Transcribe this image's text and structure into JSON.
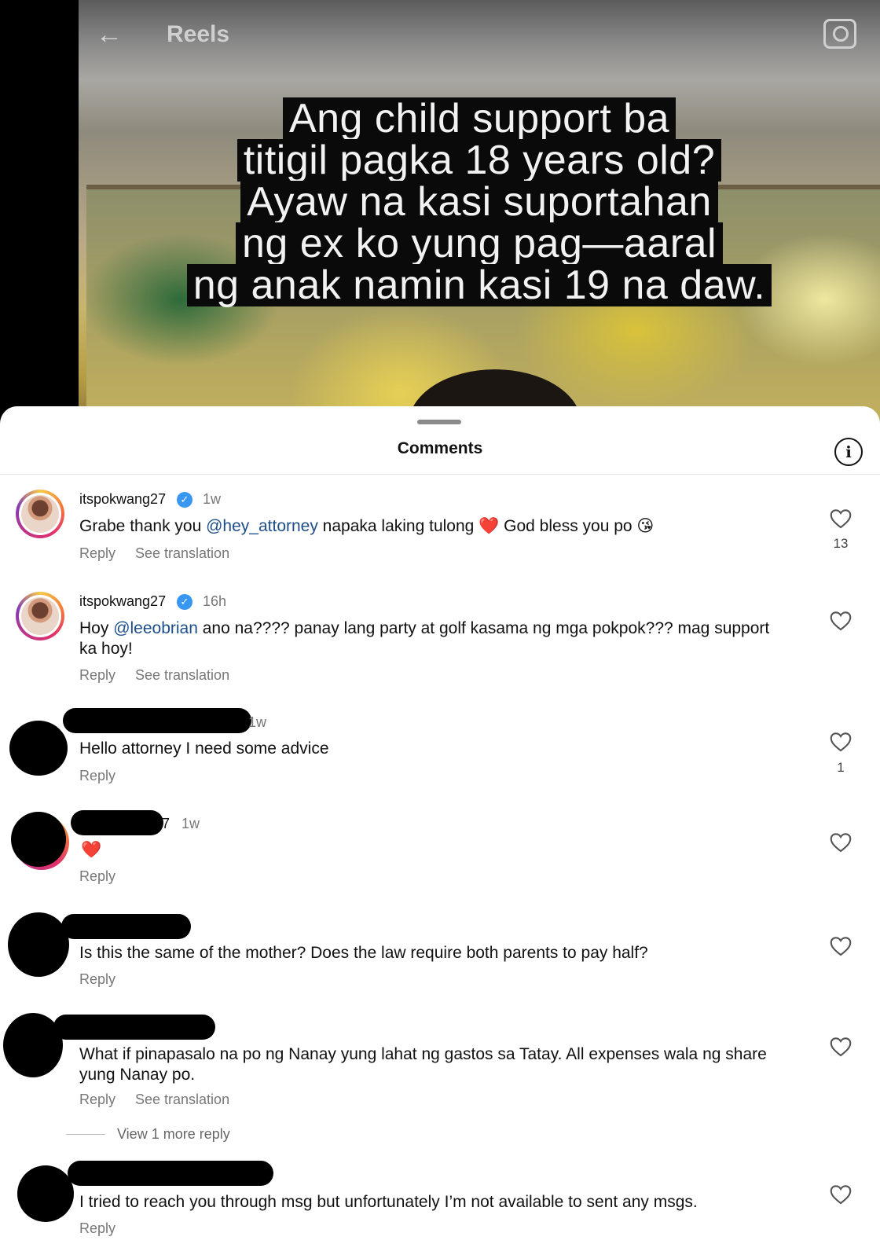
{
  "header": {
    "back_icon": "arrow-left-icon",
    "title": "Reels",
    "camera_icon": "camera-icon"
  },
  "video": {
    "caption_lines": [
      "Ang child support ba",
      "titigil pagka 18 years old?",
      "Ayaw na kasi suportahan",
      "ng ex ko yung pag—aaral",
      "ng anak namin kasi 19 na daw."
    ]
  },
  "sheet": {
    "title": "Comments",
    "info_icon": "info-icon"
  },
  "comments": [
    {
      "username": "itspokwang27",
      "verified": true,
      "time": "1w",
      "text_before": "Grabe thank you ",
      "mention": "@hey_attorney",
      "text_after": " napaka laking tulong ❤️ God bless you po 😘",
      "reply": "Reply",
      "see_translation": "See translation",
      "likes": "13"
    },
    {
      "username": "itspokwang27",
      "verified": true,
      "time": "16h",
      "text_before": "Hoy ",
      "mention": "@leeobrian",
      "text_line1_after": " ano na???? panay lang party at golf kasama ng mga pokpok??? mag support",
      "text_line2": "ka hoy!",
      "reply": "Reply",
      "see_translation": "See translation"
    },
    {
      "time_fragment": "1w",
      "text": "Hello attorney I need some advice",
      "reply": "Reply",
      "likes": "1"
    },
    {
      "user_fragment": "7",
      "time": "1w",
      "text": "❤️",
      "reply": "Reply"
    },
    {
      "text": "Is this the same of the mother? Does the law require both parents to pay half?",
      "reply": "Reply"
    },
    {
      "text_line1": "What if pinapasalo na po ng Nanay yung lahat ng gastos sa Tatay.  All expenses wala ng share",
      "text_line2": "yung Nanay po.",
      "reply": "Reply",
      "see_translation": "See translation",
      "view_more": "View 1 more reply"
    },
    {
      "text": "I tried to reach you through msg but unfortunately I’m not available to sent any msgs.",
      "reply": "Reply"
    }
  ],
  "colors": {
    "accent_blue": "#3897f0",
    "mention": "#1d4e89",
    "like_red": "#e0181e"
  }
}
